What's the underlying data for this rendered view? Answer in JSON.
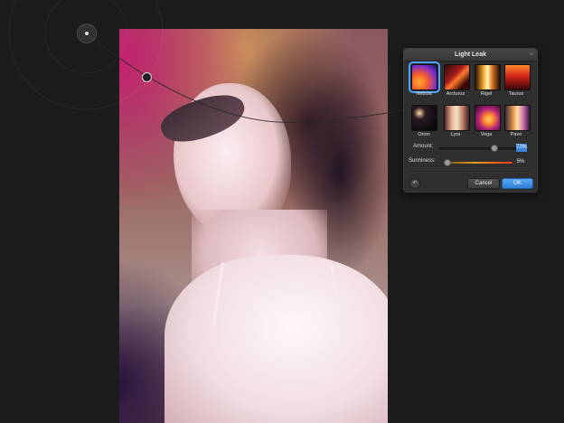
{
  "panel": {
    "title": "Light Leak",
    "close_glyph": "×",
    "presets": [
      {
        "name": "Nebula",
        "selected": true
      },
      {
        "name": "Arcturus",
        "selected": false
      },
      {
        "name": "Rigel",
        "selected": false
      },
      {
        "name": "Taurus",
        "selected": false
      },
      {
        "name": "Orion",
        "selected": false
      },
      {
        "name": "Lyra",
        "selected": false
      },
      {
        "name": "Vega",
        "selected": false
      },
      {
        "name": "Pavo",
        "selected": false
      }
    ],
    "amount": {
      "label": "Amount:",
      "value": "72%",
      "level": 0.72
    },
    "sunniness": {
      "label": "Sunniness:",
      "value": "5%",
      "level": 0.05
    },
    "reset_icon": "reset-arrow-icon",
    "reset_glyph": "↶",
    "cancel_label": "Cancel",
    "ok_label": "OK"
  },
  "colors": {
    "accent": "#3b82d9",
    "ok_button": "#2f7fd6",
    "panel_bg": "#2f2f2f",
    "canvas_bg": "#1c1c1c"
  }
}
